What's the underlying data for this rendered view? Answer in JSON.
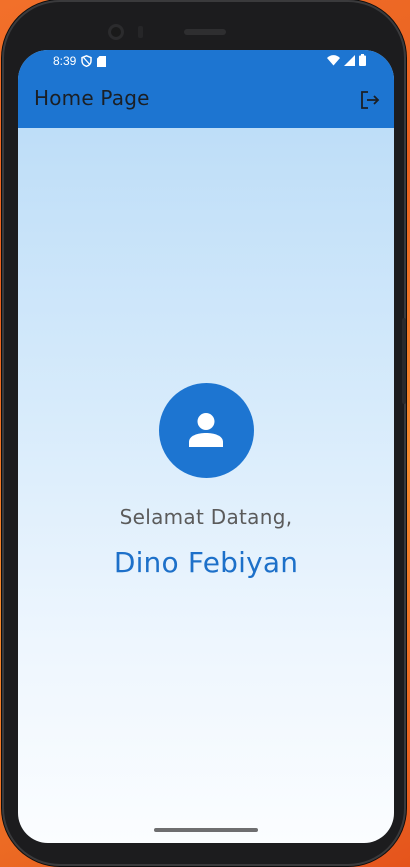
{
  "status_bar": {
    "time": "8:39",
    "icons": [
      "shield-icon",
      "sim-card-icon",
      "wifi-icon",
      "signal-icon",
      "battery-icon"
    ]
  },
  "app_bar": {
    "title": "Home Page",
    "action_icon": "logout-icon"
  },
  "main": {
    "avatar_icon": "person-icon",
    "greeting": "Selamat Datang,",
    "user_name": "Dino Febiyan"
  },
  "colors": {
    "primary": "#1d75d1",
    "name_text": "#1d70c9",
    "greeting_text": "#5b5b5b",
    "background_top": "#b7daf7",
    "background_bottom": "#fbfdff"
  }
}
